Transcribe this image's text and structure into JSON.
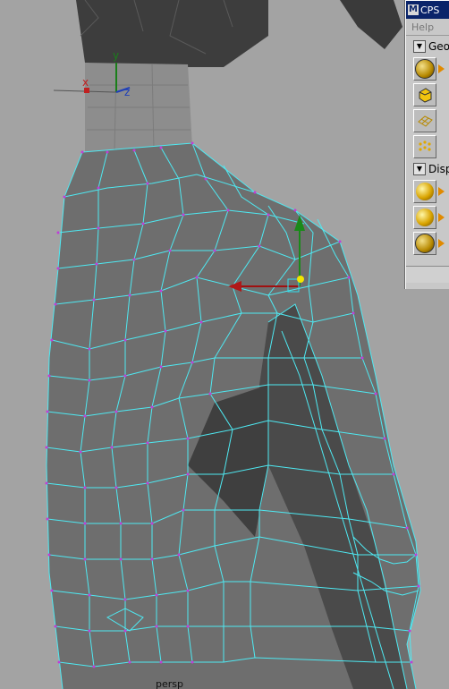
{
  "viewport": {
    "camera_label": "persp",
    "background": "#a3a3a3",
    "wire_color": "#4ee9f2",
    "vertex_color": "#c23cd6",
    "axis": {
      "x": "x",
      "y": "y",
      "z": "z"
    }
  },
  "cps_window": {
    "title": "CPS",
    "menu": {
      "help": "Help"
    },
    "sections": [
      {
        "label": "Geo",
        "tools": [
          "sphere-icon",
          "cube-icon",
          "wireframe-plane-icon",
          "grid-points-icon"
        ]
      },
      {
        "label": "Disp",
        "tools": [
          "smooth-ball-icon",
          "smooth-ball-icon",
          "wire-ball-icon"
        ]
      }
    ]
  }
}
